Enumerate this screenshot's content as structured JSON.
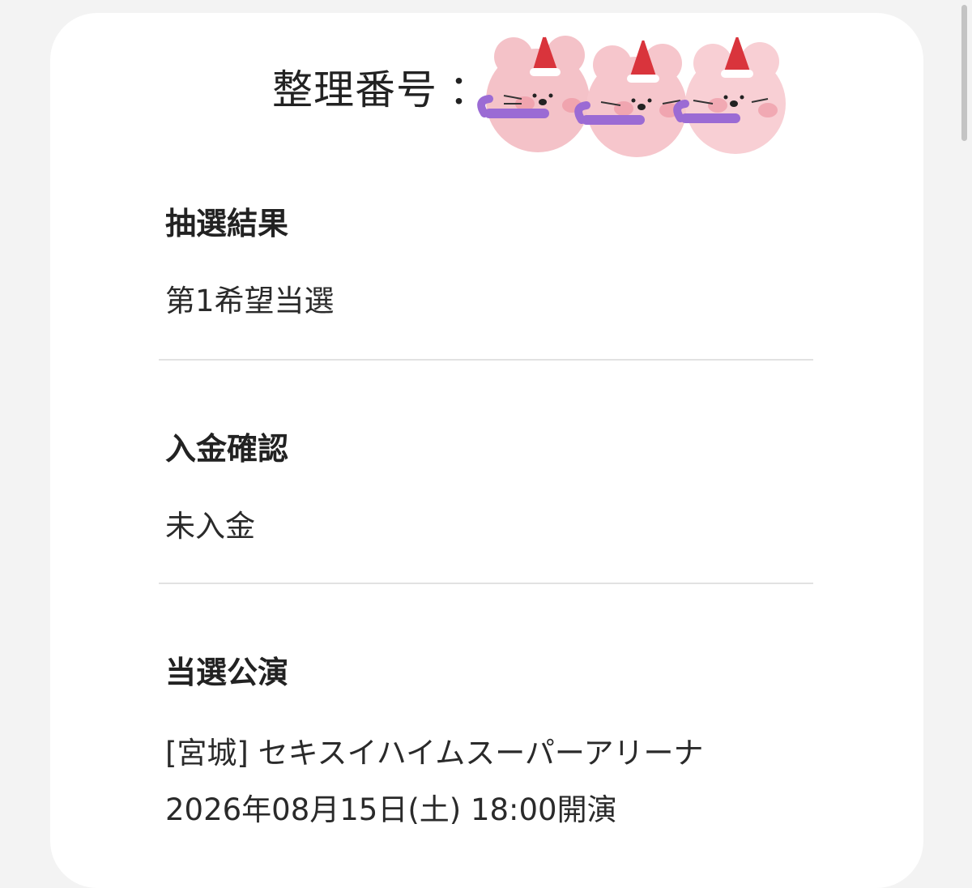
{
  "ticket": {
    "label": "整理番号",
    "colon": "："
  },
  "lottery": {
    "title": "抽選結果",
    "value": "第1希望当選"
  },
  "payment": {
    "title": "入金確認",
    "value": "未入金"
  },
  "performance": {
    "title": "当選公演",
    "venue": "[宮城] セキスイハイムスーパーアリーナ",
    "datetime": "2026年08月15日(土) 18:00開演"
  },
  "colors": {
    "background": "#f3f3f3",
    "card": "#ffffff",
    "divider": "#e2e2e2",
    "cat_face": "#f6c6cc",
    "hat": "#d9343c",
    "candy": "#9b6bd4"
  },
  "icons": [
    "santa-cat-sticker-icon"
  ]
}
